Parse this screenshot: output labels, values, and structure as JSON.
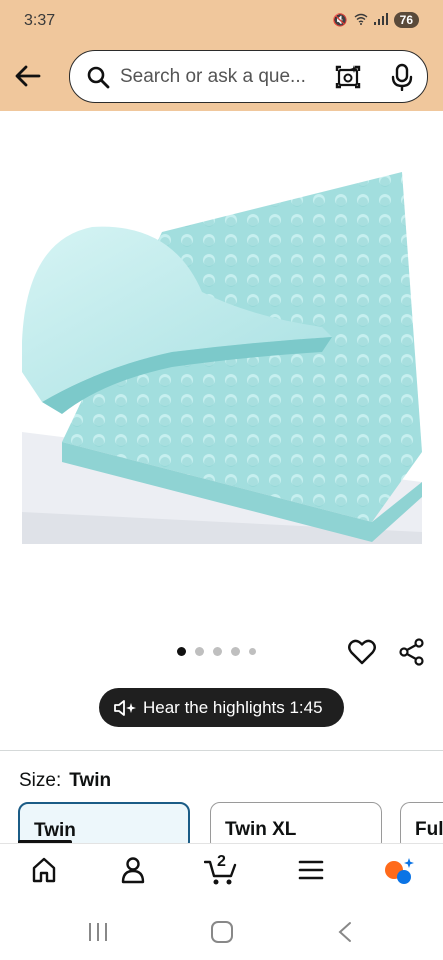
{
  "status": {
    "time": "3:37",
    "battery": "76"
  },
  "search": {
    "placeholder": "Search or ask a que..."
  },
  "header": {
    "back_icon": "arrow-left-icon",
    "lens_icon": "camera-lens-icon",
    "mic_icon": "microphone-icon"
  },
  "gallery": {
    "image_count": 5,
    "active_index": 0
  },
  "actions": {
    "hear_label": "Hear the highlights 1:45"
  },
  "size": {
    "label": "Size:",
    "selected": "Twin",
    "options": [
      "Twin",
      "Twin XL",
      "Ful"
    ]
  },
  "bottom_nav": {
    "items": [
      "home-icon",
      "account-icon",
      "cart-icon",
      "menu-icon",
      "rufus-icon"
    ],
    "cart_count": "2"
  },
  "colors": {
    "header_bg": "#f0c79c",
    "selected_border": "#1b5c86",
    "selected_bg": "#edf7fb",
    "foam": "#a8e0e0",
    "rufus_orange": "#ff6a1a",
    "rufus_blue": "#0b74e5"
  }
}
